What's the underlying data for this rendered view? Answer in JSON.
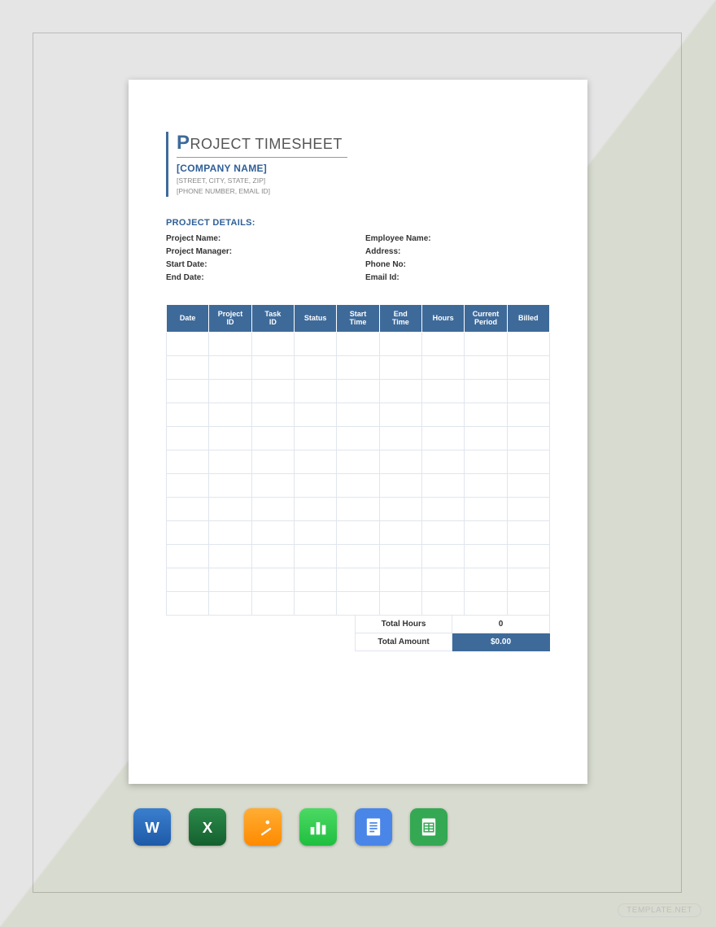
{
  "doc": {
    "title_cap": "P",
    "title_rest": "ROJECT TIMESHEET",
    "company": "[COMPANY NAME]",
    "address_line1": "[STREET, CITY, STATE, ZIP]",
    "address_line2": "[PHONE NUMBER, EMAIL ID]",
    "section_heading": "PROJECT DETAILS:",
    "left_fields": [
      "Project Name:",
      "Project Manager:",
      "Start Date:",
      "End Date:"
    ],
    "right_fields": [
      "Employee Name:",
      "Address:",
      "Phone No:",
      "Email Id:"
    ],
    "columns": [
      "Date",
      "Project ID",
      "Task ID",
      "Status",
      "Start Time",
      "End Time",
      "Hours",
      "Current Period",
      "Billed"
    ],
    "blank_rows": 12,
    "totals": {
      "hours_label": "Total Hours",
      "hours_value": "0",
      "amount_label": "Total Amount",
      "amount_value": "$0.00"
    }
  },
  "icons": [
    "word",
    "excel",
    "pages",
    "numbers",
    "docs",
    "sheets"
  ],
  "watermark": "TEMPLATE.NET"
}
